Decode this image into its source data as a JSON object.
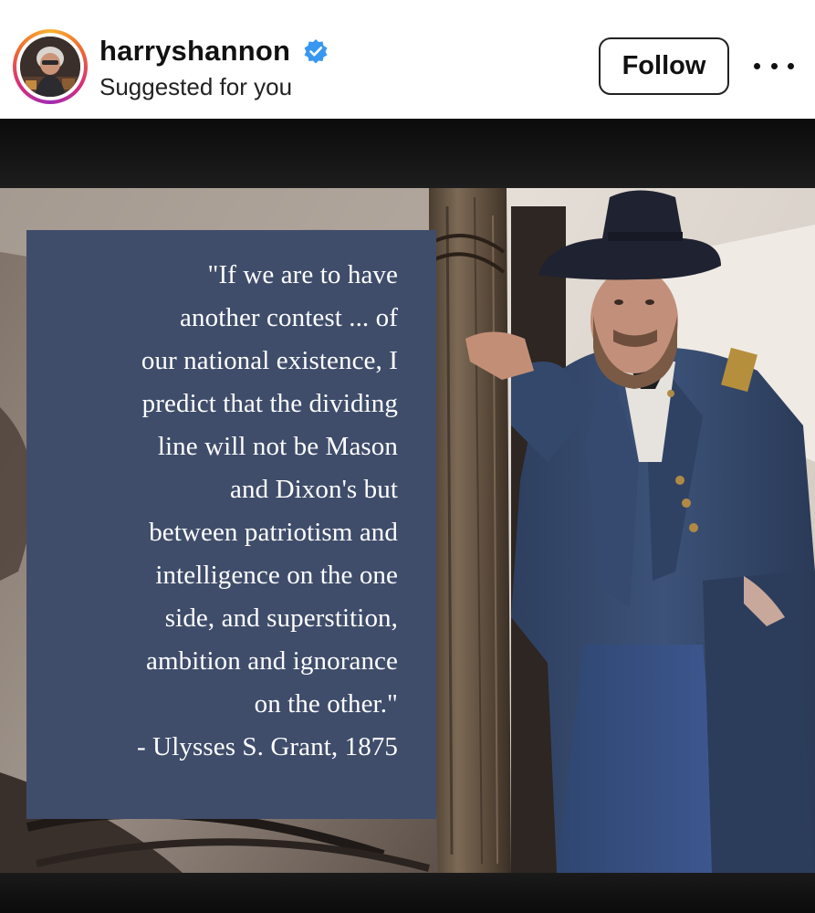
{
  "post": {
    "username": "harryshannon",
    "verified_icon": "verified-badge-icon",
    "subtitle": "Suggested for you",
    "follow_label": "Follow",
    "more_icon": "more-options-icon"
  },
  "image": {
    "quote_lines": [
      "\"If we are to have",
      "another contest ... of",
      "our national existence, I",
      "predict that the dividing",
      "line will not be Mason",
      "and Dixon's but",
      "between patriotism and",
      "intelligence on the one",
      "side, and superstition,",
      "ambition and ignorance",
      "on the other.\"",
      "- Ulysses S. Grant, 1875"
    ],
    "panel_color": "#3f4d6b"
  },
  "colors": {
    "verified": "#3897f0",
    "text": "#111111"
  }
}
